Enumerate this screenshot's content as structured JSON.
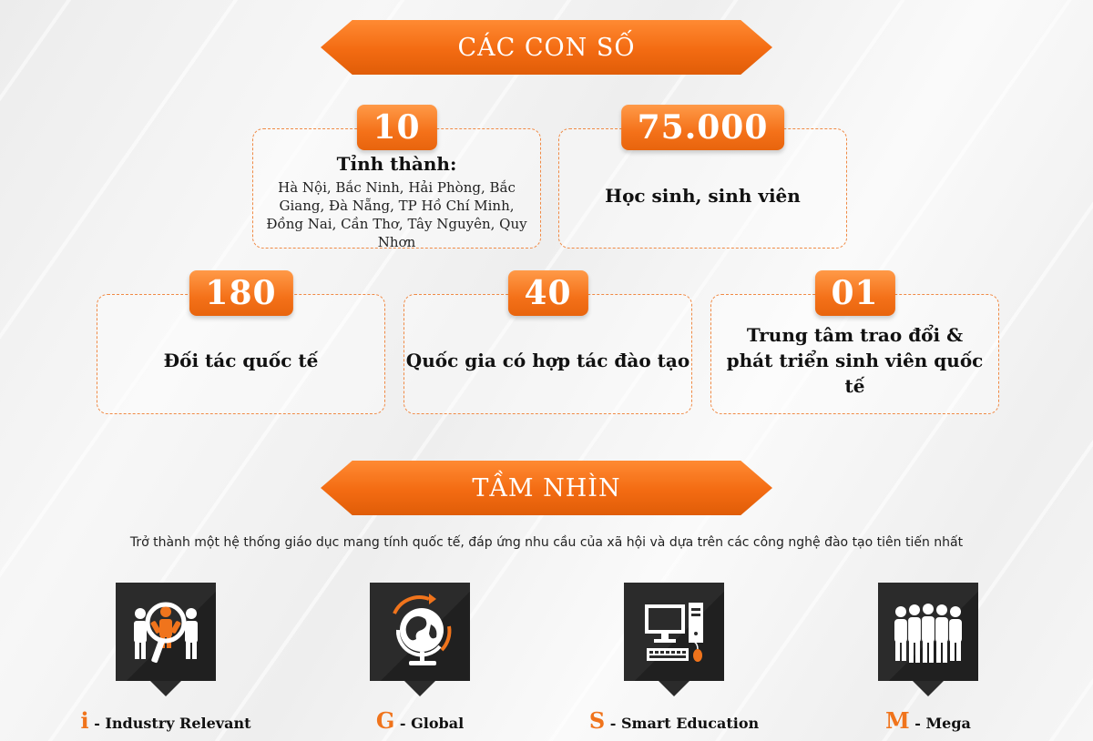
{
  "stats_header": "CÁC CON SỐ",
  "stats": [
    {
      "number": "10",
      "title": "Tỉnh thành:",
      "detail": "Hà Nội, Bắc Ninh, Hải Phòng, Bắc Giang, Đà Nẵng, TP Hồ Chí Minh, Đồng Nai, Cần Thơ, Tây Nguyên, Quy Nhơn"
    },
    {
      "number": "75.000",
      "title": "Học sinh, sinh viên"
    },
    {
      "number": "180",
      "title": "Đối tác quốc tế"
    },
    {
      "number": "40",
      "title": "Quốc gia có hợp tác đào tạo"
    },
    {
      "number": "01",
      "title": "Trung tâm trao đổi & phát triển sinh viên quốc tế"
    }
  ],
  "vision_header": "TẦM NHÌN",
  "vision_text": "Trở thành một hệ thống giáo dục mang tính quốc tế, đáp ứng nhu cầu của xã hội và dựa trên các công nghệ đào tạo tiên tiến nhất",
  "pillars": [
    {
      "letter": "i",
      "label": " - Industry Relevant",
      "icon": "people-search-icon"
    },
    {
      "letter": "G",
      "label": " - Global",
      "icon": "globe-icon"
    },
    {
      "letter": "S",
      "label": " - Smart Education",
      "icon": "computer-icon"
    },
    {
      "letter": "M",
      "label": " - Mega",
      "icon": "group-icon"
    }
  ],
  "colors": {
    "accent": "#f36b12",
    "icon_bg": "#2b2b2b",
    "text": "#111111"
  }
}
